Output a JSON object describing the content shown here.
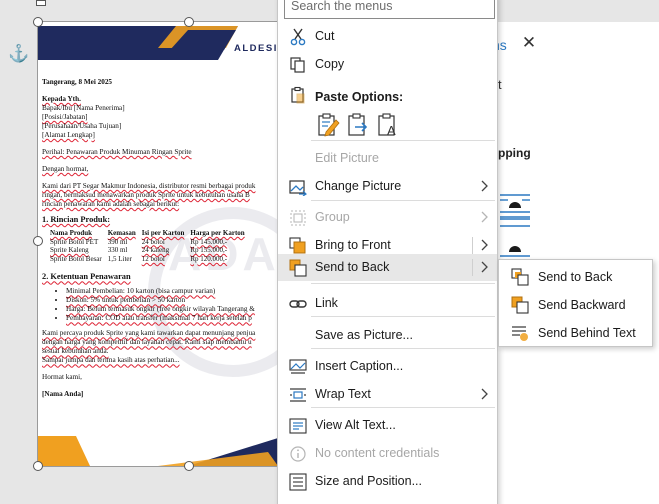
{
  "search": {
    "placeholder": "Search the menus"
  },
  "document": {
    "brand": "ALDESIGN",
    "date_line": "Tangerang, 8 Mei 2025",
    "to_label": "Kepada Yth.",
    "to_lines": [
      "Bapak/Ibu [Nama Penerima]",
      "[Posisi/Jabatan]",
      "[Perusahaan/Usaha Tujuan]",
      "[Alamat Lengkap]"
    ],
    "subject": "Perihal: Penawaran Produk Minuman Ringan Sprite",
    "greeting": "Dengan hormat,",
    "intro": [
      "Kami dari PT Segar Makmur Indonesia, distributor resmi berbagai produk",
      "ringan, bermaksud menawarkan produk Sprite untuk kebutuhan usaha B",
      "rincian penawaran kami adalah sebagai berikut:"
    ],
    "section1": "1. Rincian Produk:",
    "table_headers": [
      "Nama Produk",
      "Kemasan",
      "Isi per Karton",
      "Harga per Karton"
    ],
    "table_rows": [
      [
        "Sprite Botol PET",
        "390 ml",
        "24 botol",
        "Rp 145.000,-"
      ],
      [
        "Sprite Kaleng",
        "330 ml",
        "24 kaleng",
        "Rp 155.000,-"
      ],
      [
        "Sprite Botol Besar",
        "1,5 Liter",
        "12 botol",
        "Rp 120.000,-"
      ]
    ],
    "section2": "2. Ketentuan Penawaran",
    "terms": [
      "Minimal Pembelian: 10 karton (bisa campur varian)",
      "Diskon: 5% untuk pembelian > 50 karton",
      "Harga: Belum termasuk ongkir (free ongkir wilayah Tangerang &",
      "Pembayaran: COD atau transfer (maksimal 7 hari kerja setelah p"
    ],
    "closing": [
      "Kami percaya produk Sprite yang kami tawarkan dapat menunjang penjua",
      "dengan harga yang kompetitif dan layanan cepat. Kami siap membantu u",
      "sesuai kebutuhan anda.",
      "Sampai jumpa dan terima kasih atas perhatian..."
    ],
    "signoff": "Hormat kami,",
    "signature": "[Nama Anda]",
    "watermark": "ADA"
  },
  "pane": {
    "title_fragment": "ns",
    "text_fragment": "t",
    "section_fragment": "pping"
  },
  "menu": {
    "items": {
      "cut": "Cut",
      "copy": "Copy",
      "paste_options": "Paste Options:",
      "edit_picture": "Edit Picture",
      "change_picture": "Change Picture",
      "group": "Group",
      "bring_to_front": "Bring to Front",
      "send_to_back": "Send to Back",
      "link": "Link",
      "save_as_picture": "Save as Picture...",
      "insert_caption": "Insert Caption...",
      "wrap_text": "Wrap Text",
      "view_alt_text": "View Alt Text...",
      "no_content_credentials": "No content credentials",
      "size_and_position": "Size and Position..."
    }
  },
  "submenu": {
    "send_to_back": "Send to Back",
    "send_backward": "Send Backward",
    "send_behind_text": "Send Behind Text"
  },
  "colors": {
    "accent": "#2b79c2",
    "navy": "#1f2a5e",
    "orange": "#f0a020",
    "disabled": "#a7a7a7"
  }
}
